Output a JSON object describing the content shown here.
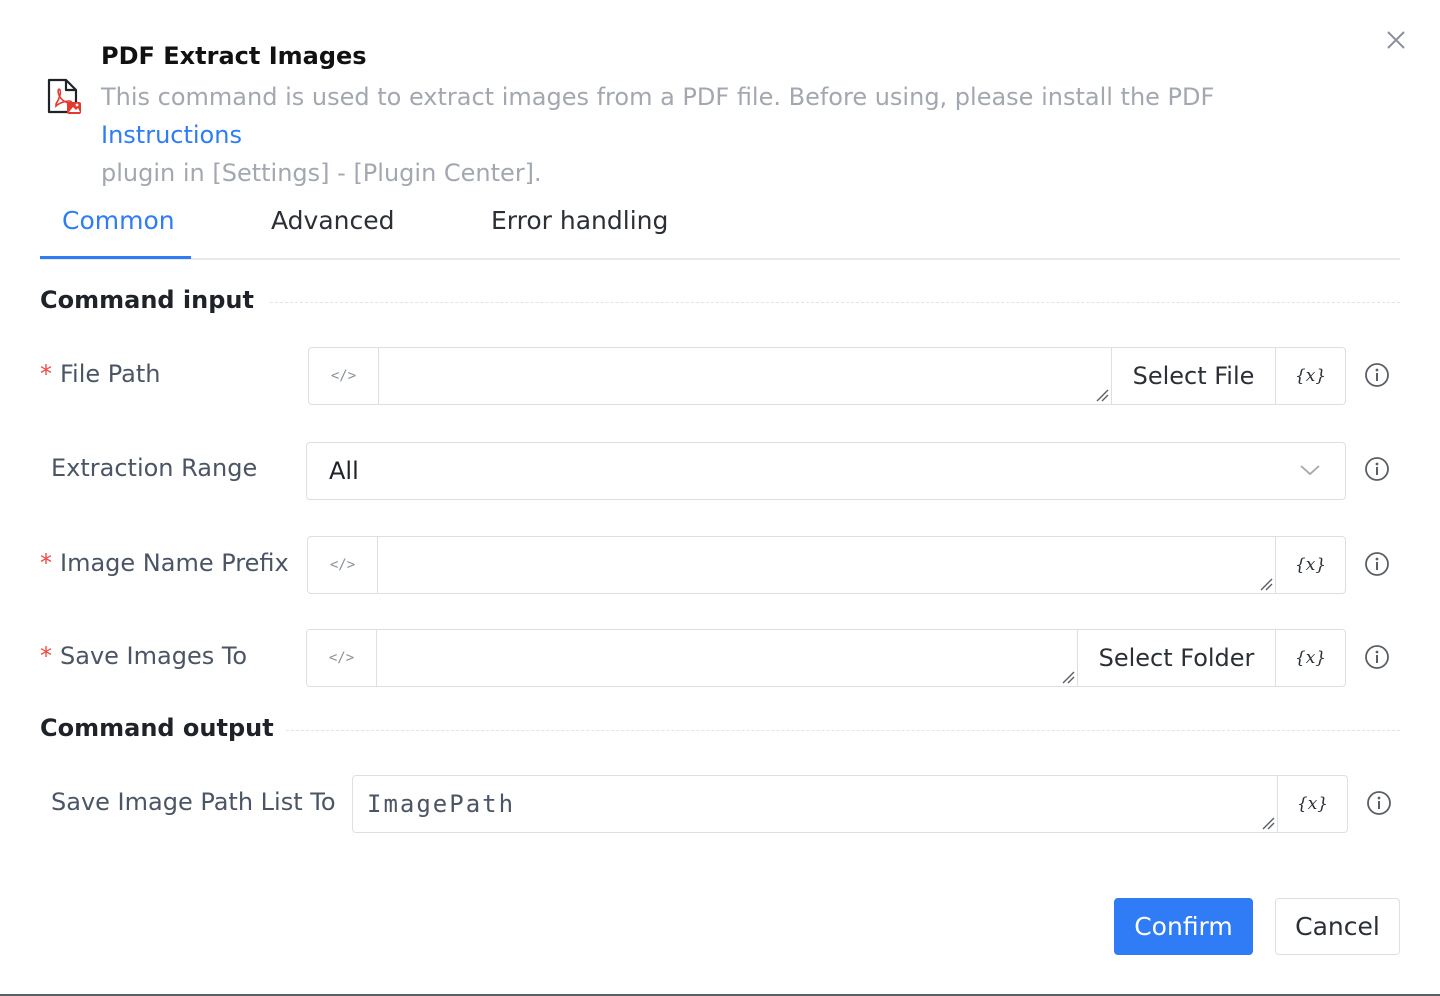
{
  "dialog": {
    "title": "PDF Extract Images",
    "description": "This command is used to extract images from a PDF file. Before using, please install the PDF plugin in [Settings] - [Plugin Center].",
    "description_part1": "This command is used to extract images from a PDF file. Before using, please install the PDF",
    "instructions_link": "Instructions",
    "description_part2": "plugin in [Settings] - [Plugin Center].",
    "icon": "pdf-image-icon"
  },
  "tabs": [
    {
      "label": "Common",
      "active": true
    },
    {
      "label": "Advanced",
      "active": false
    },
    {
      "label": "Error handling",
      "active": false
    }
  ],
  "sections": {
    "input_title": "Command input",
    "output_title": "Command output"
  },
  "fields": {
    "file_path": {
      "label": "File Path",
      "required": true,
      "value": "",
      "button": "Select File",
      "var": "{x}"
    },
    "extraction_range": {
      "label": "Extraction Range",
      "required": false,
      "value": "All"
    },
    "image_name_prefix": {
      "label": "Image Name Prefix",
      "required": true,
      "value": "",
      "var": "{x}"
    },
    "save_images_to": {
      "label": "Save Images To",
      "required": true,
      "value": "",
      "button": "Select Folder",
      "var": "{x}"
    },
    "save_image_path_list_to": {
      "label": "Save Image Path List To",
      "required": false,
      "value": "ImagePath",
      "var": "{x}"
    }
  },
  "code_toggle": "</>",
  "required_mark": "*",
  "buttons": {
    "confirm": "Confirm",
    "cancel": "Cancel"
  },
  "colors": {
    "accent": "#2f7cf6",
    "required": "#f2483e"
  }
}
